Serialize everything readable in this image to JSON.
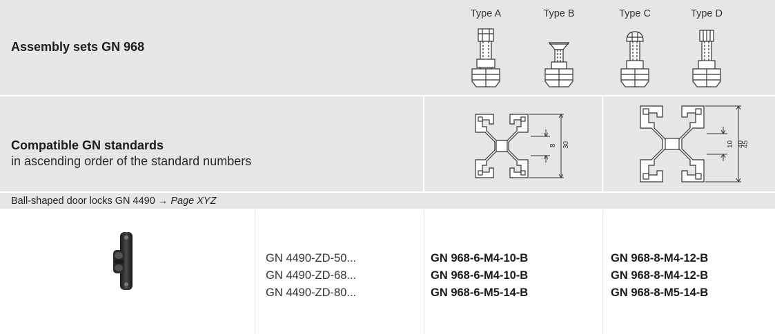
{
  "header": {
    "title": "Assembly sets GN 968",
    "types": [
      {
        "label": "Type A",
        "icon": "screw-type-a-icon"
      },
      {
        "label": "Type B",
        "icon": "screw-type-b-icon"
      },
      {
        "label": "Type C",
        "icon": "screw-type-c-icon"
      },
      {
        "label": "Type D",
        "icon": "screw-type-d-icon"
      }
    ]
  },
  "compat": {
    "title": "Compatible GN standards",
    "subtitle": "in ascending order of the standard numbers",
    "profiles": [
      {
        "icon": "profile-30-icon",
        "dims": [
          "8",
          "30"
        ]
      },
      {
        "icon": "profile-45-icon",
        "dims": [
          "10",
          "40",
          "45"
        ]
      }
    ]
  },
  "group": {
    "text": "Ball-shaped door locks GN 4490 → ",
    "page": "Page XYZ"
  },
  "row": {
    "image": "ball-door-lock-photo",
    "gn_codes": [
      "GN 4490-ZD-50...",
      "GN 4490-ZD-68...",
      "GN 4490-ZD-80..."
    ],
    "sets_30": [
      "GN 968-6-M4-10-B",
      "GN 968-6-M4-10-B",
      "GN 968-6-M5-14-B"
    ],
    "sets_45": [
      "GN 968-8-M4-12-B",
      "GN 968-8-M4-12-B",
      "GN 968-8-M5-14-B"
    ]
  },
  "colors": {
    "header_bg": "#e6e6e6",
    "cell_bg": "#ffffff",
    "divider": "#ffffff"
  }
}
